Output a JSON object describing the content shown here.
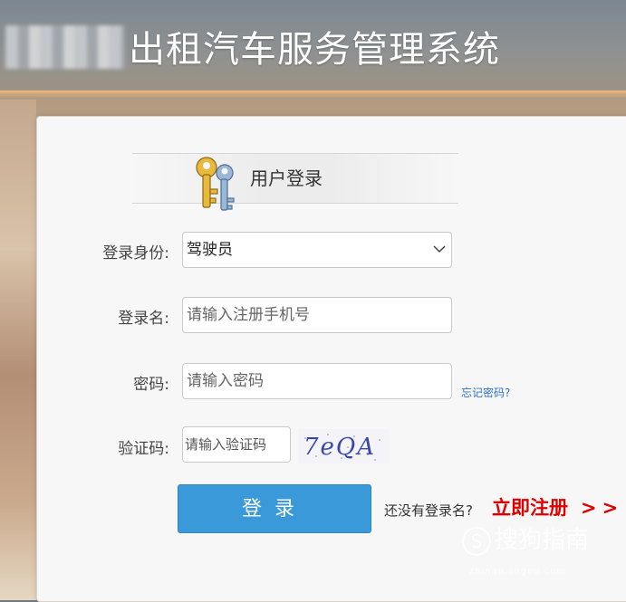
{
  "header": {
    "title": "出租汽车服务管理系统"
  },
  "login": {
    "title": "用户登录",
    "identity": {
      "label": "登录身份:",
      "selected": "驾驶员"
    },
    "username": {
      "label": "登录名:",
      "placeholder": "请输入注册手机号"
    },
    "password": {
      "label": "密码:",
      "placeholder": "请输入密码",
      "forgot_link": "忘记密码?"
    },
    "captcha": {
      "label": "验证码:",
      "placeholder": "请输入验证码",
      "code_text": "7eQA"
    },
    "submit_label": "登录",
    "no_account_text": "还没有登录名?",
    "register_link": "立即注册",
    "register_arrow": ">>"
  },
  "watermark": {
    "text": "搜狗指南",
    "sub": "zhinan.sogou.com"
  },
  "colors": {
    "button": "#3a9ad9",
    "register": "#e10000",
    "link": "#2f74c5"
  }
}
